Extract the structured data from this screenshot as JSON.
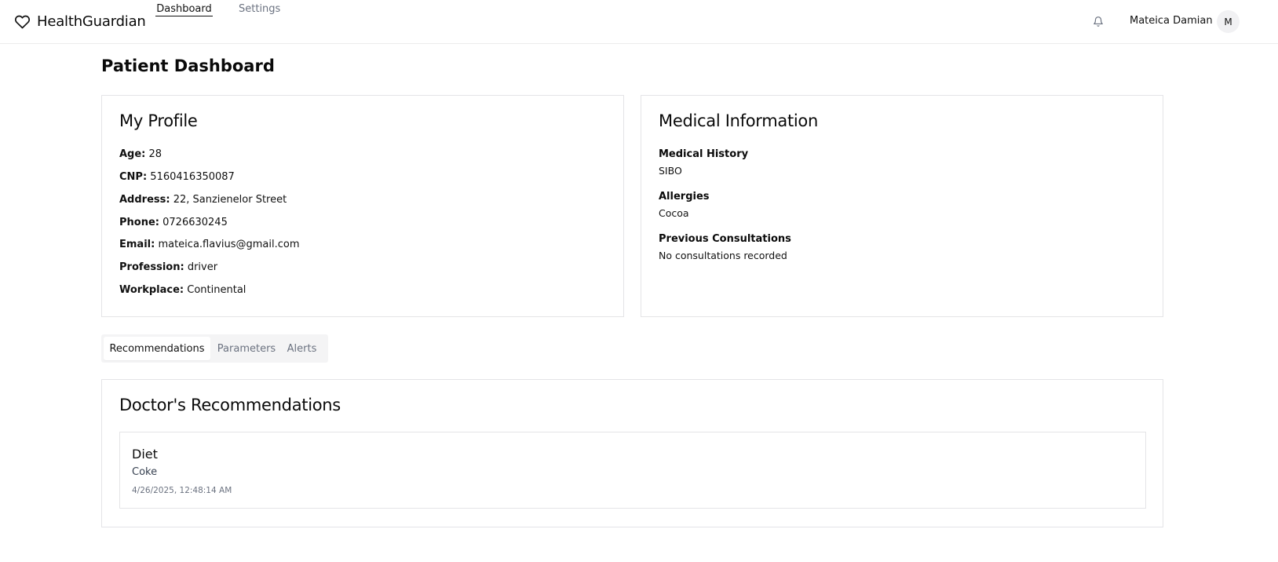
{
  "brand": {
    "name": "HealthGuardian",
    "icon": "heart-icon"
  },
  "nav": [
    {
      "label": "Dashboard",
      "active": true
    },
    {
      "label": "Settings",
      "active": false
    }
  ],
  "header": {
    "notification_icon": "bell-icon",
    "user_name": "Mateica Damian",
    "avatar_initial": "M"
  },
  "page": {
    "title": "Patient Dashboard"
  },
  "profile": {
    "title": "My Profile",
    "fields": [
      {
        "label": "Age:",
        "value": "28"
      },
      {
        "label": "CNP:",
        "value": "5160416350087"
      },
      {
        "label": "Address:",
        "value": "22, Sanzienelor Street"
      },
      {
        "label": "Phone:",
        "value": "0726630245"
      },
      {
        "label": "Email:",
        "value": "mateica.flavius@gmail.com"
      },
      {
        "label": "Profession:",
        "value": "driver"
      },
      {
        "label": "Workplace:",
        "value": "Continental"
      }
    ]
  },
  "medical": {
    "title": "Medical Information",
    "sections": [
      {
        "label": "Medical History",
        "value": "SIBO"
      },
      {
        "label": "Allergies",
        "value": "Cocoa"
      },
      {
        "label": "Previous Consultations",
        "value": "No consultations recorded"
      }
    ]
  },
  "tabs": [
    {
      "label": "Recommendations",
      "active": true
    },
    {
      "label": "Parameters",
      "active": false
    },
    {
      "label": "Alerts",
      "active": false
    }
  ],
  "recommendations": {
    "title": "Doctor's Recommendations",
    "items": [
      {
        "type": "Diet",
        "text": "Coke",
        "timestamp": "4/26/2025, 12:48:14 AM"
      }
    ]
  }
}
